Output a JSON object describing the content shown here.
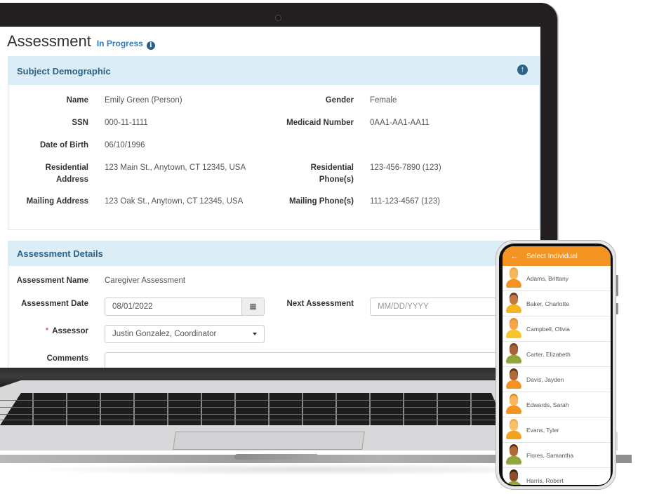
{
  "page": {
    "title": "Assessment",
    "status": "In Progress",
    "info_icon": "info-circle-icon"
  },
  "subject_demographic": {
    "heading": "Subject Demographic",
    "collapse_icon": "arrow-circle-up-icon",
    "fields": [
      {
        "label": "Name",
        "value": "Emily Green (Person)"
      },
      {
        "label": "SSN",
        "value": "000-11-1111"
      },
      {
        "label": "Date of Birth",
        "value": "06/10/1996"
      },
      {
        "label": "Residential Address",
        "value": "123 Main St., Anytown, CT 12345, USA"
      },
      {
        "label": "Mailing Address",
        "value": "123 Oak St., Anytown, CT 12345, USA"
      },
      {
        "label": "Gender",
        "value": "Female"
      },
      {
        "label": "Medicaid Number",
        "value": "0AA1-AA1-AA11"
      },
      {
        "label": "Residential Phone(s)",
        "value": "123-456-7890 (123)"
      },
      {
        "label": "Mailing Phone(s)",
        "value": "111-123-4567 (123)"
      }
    ]
  },
  "assessment_details": {
    "heading": "Assessment Details",
    "assessment_name_label": "Assessment Name",
    "assessment_name_value": "Caregiver Assessment",
    "assessment_date_label": "Assessment Date",
    "assessment_date_value": "08/01/2022",
    "calendar_icon": "calendar-icon",
    "next_assessment_label": "Next Assessment",
    "next_assessment_placeholder": "MM/DD/YYYY",
    "assessor_required_mark": "*",
    "assessor_label": "Assessor",
    "assessor_value": "Justin Gonzalez, Coordinator",
    "comments_label": "Comments",
    "comments_value": ""
  },
  "phone": {
    "header_title": "Select Individual",
    "back_icon": "arrow-left-icon",
    "individuals": [
      {
        "name": "Adams, Brittany",
        "hair": "#f0a84a",
        "skin": "#f6b75a",
        "shirt": "#f39322"
      },
      {
        "name": "Baker, Charlotte",
        "hair": "#6b3a1e",
        "skin": "#c07a45",
        "shirt": "#f3b522"
      },
      {
        "name": "Campbell, Olivia",
        "hair": "#e88a2a",
        "skin": "#f4a64a",
        "shirt": "#f7c52a"
      },
      {
        "name": "Carter, Elizabeth",
        "hair": "#7a4520",
        "skin": "#a8623a",
        "shirt": "#8fa63a"
      },
      {
        "name": "Davis, Jayden",
        "hair": "#5a2e14",
        "skin": "#b06a38",
        "shirt": "#f39322"
      },
      {
        "name": "Edwards, Sarah",
        "hair": "#e88a2a",
        "skin": "#f6b75a",
        "shirt": "#f39322"
      },
      {
        "name": "Evans, Tyler",
        "hair": "#f0a84a",
        "skin": "#f6c06a",
        "shirt": "#f3a322"
      },
      {
        "name": "Flores, Samantha",
        "hair": "#5a2e14",
        "skin": "#b06a38",
        "shirt": "#8fa63a"
      },
      {
        "name": "Harris, Robert",
        "hair": "#3a1e0e",
        "skin": "#8a4e28",
        "shirt": "#8fa63a"
      }
    ]
  }
}
